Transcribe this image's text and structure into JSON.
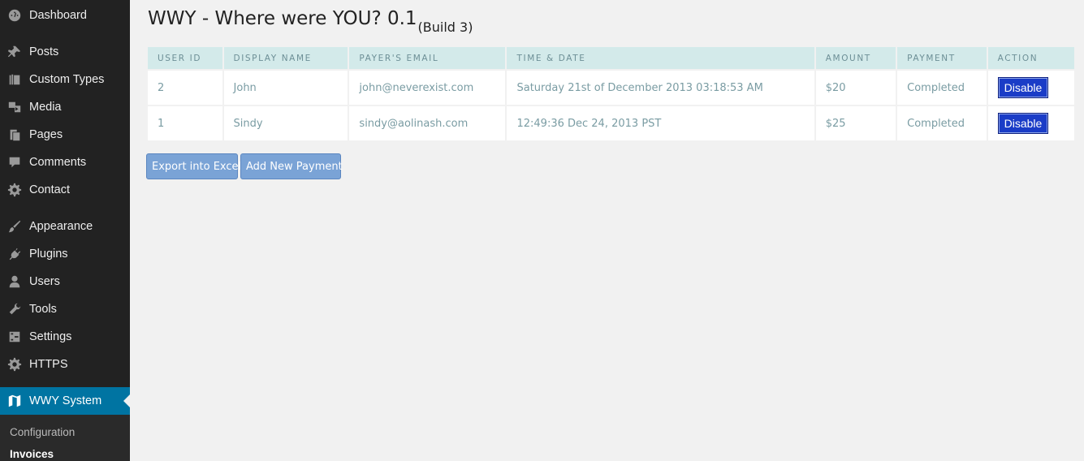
{
  "sidebar": {
    "items": [
      {
        "label": "Dashboard",
        "icon": "dashboard-icon"
      },
      {
        "label": "Posts",
        "icon": "pin-icon"
      },
      {
        "label": "Custom Types",
        "icon": "stack-icon"
      },
      {
        "label": "Media",
        "icon": "media-icon"
      },
      {
        "label": "Pages",
        "icon": "pages-icon"
      },
      {
        "label": "Comments",
        "icon": "comment-icon"
      },
      {
        "label": "Contact",
        "icon": "gear-icon"
      },
      {
        "label": "Appearance",
        "icon": "brush-icon"
      },
      {
        "label": "Plugins",
        "icon": "plug-icon"
      },
      {
        "label": "Users",
        "icon": "user-icon"
      },
      {
        "label": "Tools",
        "icon": "wrench-icon"
      },
      {
        "label": "Settings",
        "icon": "sliders-icon"
      },
      {
        "label": "HTTPS",
        "icon": "gear-icon"
      },
      {
        "label": "WWY System",
        "icon": "map-icon"
      }
    ],
    "submenu": [
      {
        "label": "Configuration"
      },
      {
        "label": "Invoices"
      }
    ],
    "colors": {
      "background": "#222222",
      "active": "#0074a2"
    }
  },
  "page": {
    "title": "WWY - Where were YOU? 0.1",
    "build": "(Build 3)"
  },
  "table": {
    "columns": [
      "USER ID",
      "DISPLAY NAME",
      "PAYER'S EMAIL",
      "TIME & DATE",
      "AMOUNT",
      "PAYMENT",
      "ACTION"
    ],
    "rows": [
      {
        "user_id": "2",
        "display_name": "John",
        "email": "john@neverexist.com",
        "time_date": "Saturday 21st of December 2013 03:18:53 AM",
        "amount": "$20",
        "payment": "Completed",
        "action": "Disable"
      },
      {
        "user_id": "1",
        "display_name": "Sindy",
        "email": "sindy@aolinash.com",
        "time_date": "12:49:36 Dec 24, 2013 PST",
        "amount": "$25",
        "payment": "Completed",
        "action": "Disable"
      }
    ],
    "colors": {
      "header_bg": "#d3eaea",
      "text": "#7a9ca3",
      "button": "#1a3cc7"
    }
  },
  "buttons": {
    "export": "Export into Excel",
    "add_payment": "Add New Payment"
  }
}
